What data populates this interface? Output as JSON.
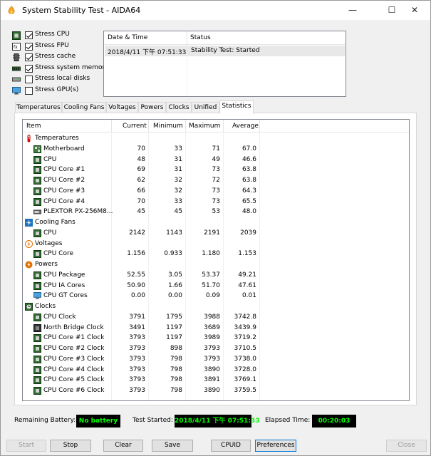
{
  "window": {
    "title": "System Stability Test - AIDA64",
    "minimize_glyph": "—",
    "maximize_glyph": "☐",
    "close_glyph": "✕"
  },
  "stress_options": [
    {
      "label": "Stress CPU",
      "checked": true,
      "icon": "cpu-chip-icon"
    },
    {
      "label": "Stress FPU",
      "checked": true,
      "icon": "fpu-icon"
    },
    {
      "label": "Stress cache",
      "checked": true,
      "icon": "cache-icon"
    },
    {
      "label": "Stress system memory",
      "checked": true,
      "icon": "memory-module-icon"
    },
    {
      "label": "Stress local disks",
      "checked": false,
      "icon": "disk-drive-icon"
    },
    {
      "label": "Stress GPU(s)",
      "checked": false,
      "icon": "gpu-monitor-icon"
    }
  ],
  "log": {
    "col_date": "Date & Time",
    "col_status": "Status",
    "rows": [
      {
        "date": "2018/4/11 下午 07:51:33",
        "status": "Stability Test: Started"
      }
    ]
  },
  "tabs": [
    {
      "label": "Temperatures",
      "active": false
    },
    {
      "label": "Cooling Fans",
      "active": false
    },
    {
      "label": "Voltages",
      "active": false
    },
    {
      "label": "Powers",
      "active": false
    },
    {
      "label": "Clocks",
      "active": false
    },
    {
      "label": "Unified",
      "active": false
    },
    {
      "label": "Statistics",
      "active": true
    }
  ],
  "stats": {
    "columns": [
      "Item",
      "Current",
      "Minimum",
      "Maximum",
      "Average"
    ],
    "groups": [
      {
        "name": "Temperatures",
        "icon": "thermometer-icon",
        "rows": [
          {
            "item": "Motherboard",
            "icon": "motherboard-icon",
            "current": "70",
            "minimum": "33",
            "maximum": "71",
            "average": "67.0"
          },
          {
            "item": "CPU",
            "icon": "cpu-chip-icon",
            "current": "48",
            "minimum": "31",
            "maximum": "49",
            "average": "46.6"
          },
          {
            "item": "CPU Core #1",
            "icon": "cpu-chip-icon",
            "current": "69",
            "minimum": "31",
            "maximum": "73",
            "average": "63.8"
          },
          {
            "item": "CPU Core #2",
            "icon": "cpu-chip-icon",
            "current": "62",
            "minimum": "32",
            "maximum": "72",
            "average": "63.8"
          },
          {
            "item": "CPU Core #3",
            "icon": "cpu-chip-icon",
            "current": "66",
            "minimum": "32",
            "maximum": "73",
            "average": "64.3"
          },
          {
            "item": "CPU Core #4",
            "icon": "cpu-chip-icon",
            "current": "70",
            "minimum": "33",
            "maximum": "73",
            "average": "65.5"
          },
          {
            "item": "PLEXTOR PX-256M8...",
            "icon": "ssd-icon",
            "current": "45",
            "minimum": "45",
            "maximum": "53",
            "average": "48.0"
          }
        ]
      },
      {
        "name": "Cooling Fans",
        "icon": "fan-icon",
        "rows": [
          {
            "item": "CPU",
            "icon": "cpu-chip-icon",
            "current": "2142",
            "minimum": "1143",
            "maximum": "2191",
            "average": "2039"
          }
        ]
      },
      {
        "name": "Voltages",
        "icon": "voltage-icon",
        "rows": [
          {
            "item": "CPU Core",
            "icon": "cpu-chip-icon",
            "current": "1.156",
            "minimum": "0.933",
            "maximum": "1.180",
            "average": "1.153"
          }
        ]
      },
      {
        "name": "Powers",
        "icon": "power-icon",
        "rows": [
          {
            "item": "CPU Package",
            "icon": "cpu-chip-icon",
            "current": "52.55",
            "minimum": "3.05",
            "maximum": "53.37",
            "average": "49.21"
          },
          {
            "item": "CPU IA Cores",
            "icon": "cpu-chip-icon",
            "current": "50.90",
            "minimum": "1.66",
            "maximum": "51.70",
            "average": "47.61"
          },
          {
            "item": "CPU GT Cores",
            "icon": "gpu-monitor-icon",
            "current": "0.00",
            "minimum": "0.00",
            "maximum": "0.09",
            "average": "0.01"
          }
        ]
      },
      {
        "name": "Clocks",
        "icon": "clock-chip-icon",
        "rows": [
          {
            "item": "CPU Clock",
            "icon": "cpu-chip-icon",
            "current": "3791",
            "minimum": "1795",
            "maximum": "3988",
            "average": "3742.8"
          },
          {
            "item": "North Bridge Clock",
            "icon": "northbridge-icon",
            "current": "3491",
            "minimum": "1197",
            "maximum": "3689",
            "average": "3439.9"
          },
          {
            "item": "CPU Core #1 Clock",
            "icon": "cpu-chip-icon",
            "current": "3793",
            "minimum": "1197",
            "maximum": "3989",
            "average": "3719.2"
          },
          {
            "item": "CPU Core #2 Clock",
            "icon": "cpu-chip-icon",
            "current": "3793",
            "minimum": "898",
            "maximum": "3793",
            "average": "3710.5"
          },
          {
            "item": "CPU Core #3 Clock",
            "icon": "cpu-chip-icon",
            "current": "3793",
            "minimum": "798",
            "maximum": "3793",
            "average": "3738.0"
          },
          {
            "item": "CPU Core #4 Clock",
            "icon": "cpu-chip-icon",
            "current": "3793",
            "minimum": "798",
            "maximum": "3890",
            "average": "3728.0"
          },
          {
            "item": "CPU Core #5 Clock",
            "icon": "cpu-chip-icon",
            "current": "3793",
            "minimum": "798",
            "maximum": "3891",
            "average": "3769.1"
          },
          {
            "item": "CPU Core #6 Clock",
            "icon": "cpu-chip-icon",
            "current": "3793",
            "minimum": "798",
            "maximum": "3890",
            "average": "3759.5"
          }
        ]
      }
    ]
  },
  "status_bar": {
    "battery_label": "Remaining Battery:",
    "battery_value": "No battery",
    "started_label": "Test Started:",
    "started_value": "2018/4/11 下午 07:51:33",
    "elapsed_label": "Elapsed Time:",
    "elapsed_value": "00:20:03"
  },
  "buttons": {
    "start": "Start",
    "stop": "Stop",
    "clear": "Clear",
    "save": "Save",
    "cpuid": "CPUID",
    "preferences": "Preferences",
    "close": "Close"
  },
  "colors": {
    "status_text": "#00ff00",
    "status_bg": "#000000",
    "accent": "#0078d7"
  }
}
